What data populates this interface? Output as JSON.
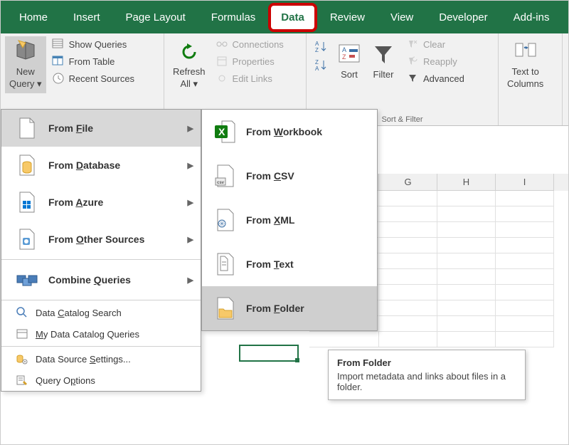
{
  "tabs": {
    "home": "Home",
    "insert": "Insert",
    "page_layout": "Page Layout",
    "formulas": "Formulas",
    "data": "Data",
    "review": "Review",
    "view": "View",
    "developer": "Developer",
    "addins": "Add-ins"
  },
  "ribbon": {
    "new_query": "New\nQuery",
    "show_queries": "Show Queries",
    "from_table": "From Table",
    "recent_sources": "Recent Sources",
    "refresh_all": "Refresh\nAll",
    "connections": "Connections",
    "properties": "Properties",
    "edit_links": "Edit Links",
    "sort": "Sort",
    "filter": "Filter",
    "clear": "Clear",
    "reapply": "Reapply",
    "advanced": "Advanced",
    "sort_filter_group": "Sort & Filter",
    "text_to_columns": "Text to\nColumns"
  },
  "menu1": {
    "from_file": "From File",
    "from_database": "From Database",
    "from_azure": "From Azure",
    "from_other_sources": "From Other Sources",
    "combine_queries": "Combine Queries",
    "data_catalog_search": "Data Catalog Search",
    "my_data_catalog_queries": "My Data Catalog Queries",
    "data_source_settings": "Data Source Settings...",
    "query_options": "Query Options"
  },
  "menu2": {
    "from_workbook": "From Workbook",
    "from_csv": "From CSV",
    "from_xml": "From XML",
    "from_text": "From Text",
    "from_folder": "From Folder"
  },
  "tooltip": {
    "title": "From Folder",
    "body": "Import metadata and links about files in a folder."
  },
  "columns": [
    "G",
    "H",
    "I"
  ]
}
